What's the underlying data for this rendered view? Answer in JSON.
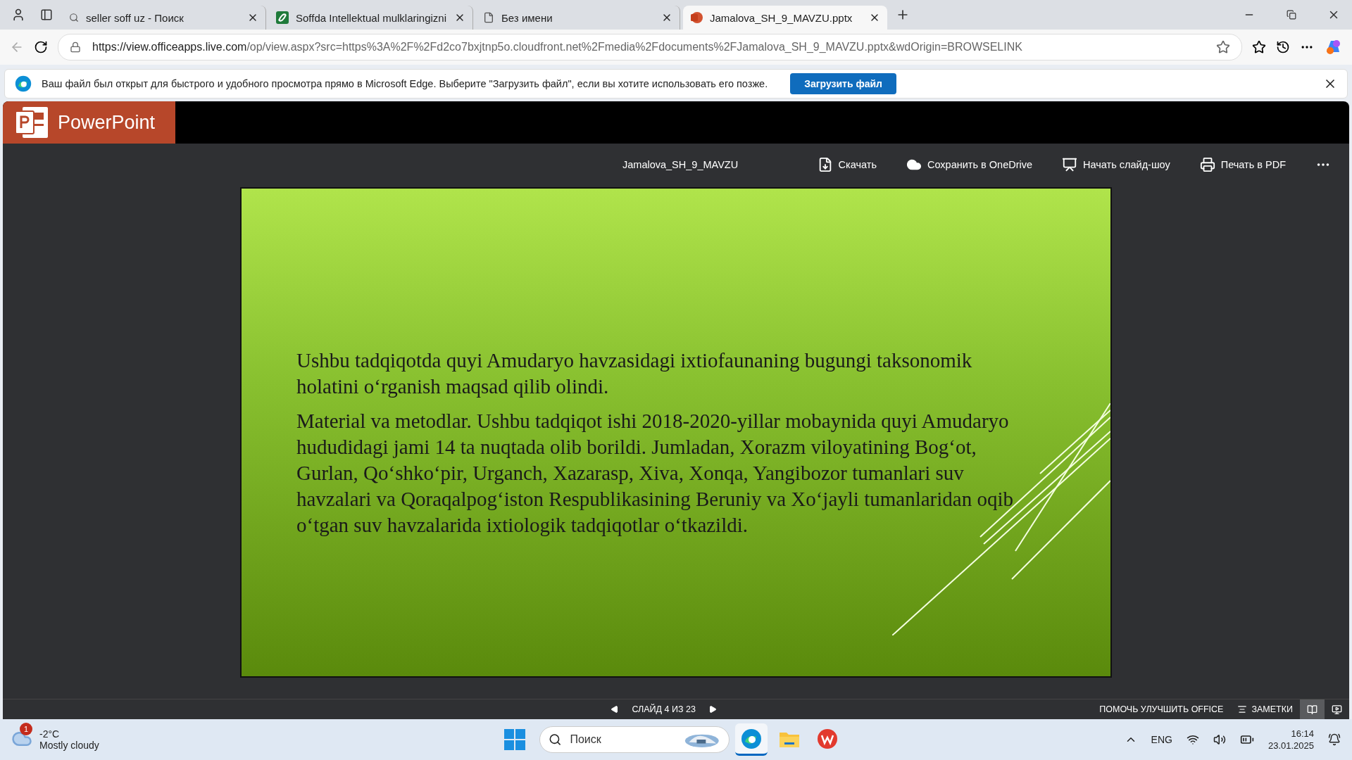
{
  "browser": {
    "tabs": [
      {
        "label": "seller soff uz - Поиск",
        "kind": "search",
        "selected": false
      },
      {
        "label": "Soffda Intellektual mulklaringizni",
        "kind": "site",
        "selected": false
      },
      {
        "label": "Без имени",
        "kind": "page",
        "selected": false
      },
      {
        "label": "Jamalova_SH_9_MAVZU.pptx",
        "kind": "pptx",
        "selected": true
      }
    ],
    "url_host": "https://view.officeapps.live.com",
    "url_path": "/op/view.aspx?src=https%3A%2F%2Fd2co7bxjtnp5o.cloudfront.net%2Fmedia%2Fdocuments%2FJamalova_SH_9_MAVZU.pptx&wdOrigin=BROWSELINK",
    "infobar": {
      "message": "Ваш файл был открыт для быстрого и удобного просмотра прямо в Microsoft Edge. Выберите \"Загрузить файл\", если вы хотите использовать его позже.",
      "button": "Загрузить файл"
    }
  },
  "app": {
    "name": "PowerPoint",
    "file_name": "Jamalova_SH_9_MAVZU",
    "actions": [
      {
        "label": "Скачать",
        "kind": "download"
      },
      {
        "label": "Сохранить в OneDrive",
        "kind": "cloud"
      },
      {
        "label": "Начать слайд-шоу",
        "kind": "slideshow"
      },
      {
        "label": "Печать в PDF",
        "kind": "print"
      }
    ]
  },
  "slide": {
    "paragraphs": [
      "Ushbu tadqiqotda quyi Amudaryo havzasidagi ixtiofaunaning bugungi taksonomik holatini o‘rganish  maqsad qilib olindi.",
      "Material va metodlar. Ushbu tadqiqot ishi 2018-2020-yillar mobaynida quyi Amudaryo hududidagi  jami 14 ta nuqtada olib borildi. Jumladan, Xorazm viloyatining Bog‘ot, Gurlan, Qo‘shko‘pir, Urganch,  Xazarasp, Xiva, Xonqa, Yangibozor tumanlari suv havzalari va Qoraqalpog‘iston Respublikasining Beruniy  va Xo‘jayli tumanlaridan oqib o‘tgan suv havzalarida ixtiologik tadqiqotlar o‘tkazildi."
    ]
  },
  "status_bar": {
    "slide_counter": "СЛАЙД 4 ИЗ 23",
    "help": "ПОМОЧЬ УЛУЧШИТЬ OFFICE",
    "notes": "ЗАМЕТКИ",
    "views": [
      {
        "kind": "reading",
        "selected": true
      },
      {
        "kind": "slideshow",
        "selected": false
      }
    ]
  },
  "taskbar": {
    "weather": {
      "badge": "1",
      "temp": "-2°C",
      "condition": "Mostly cloudy"
    },
    "search_placeholder": "Поиск",
    "apps": [
      {
        "kind": "edge",
        "selected": true
      },
      {
        "kind": "folder",
        "selected": false
      },
      {
        "kind": "wps",
        "selected": false
      }
    ],
    "language": "ENG",
    "time": "16:14",
    "date": "23.01.2025"
  }
}
